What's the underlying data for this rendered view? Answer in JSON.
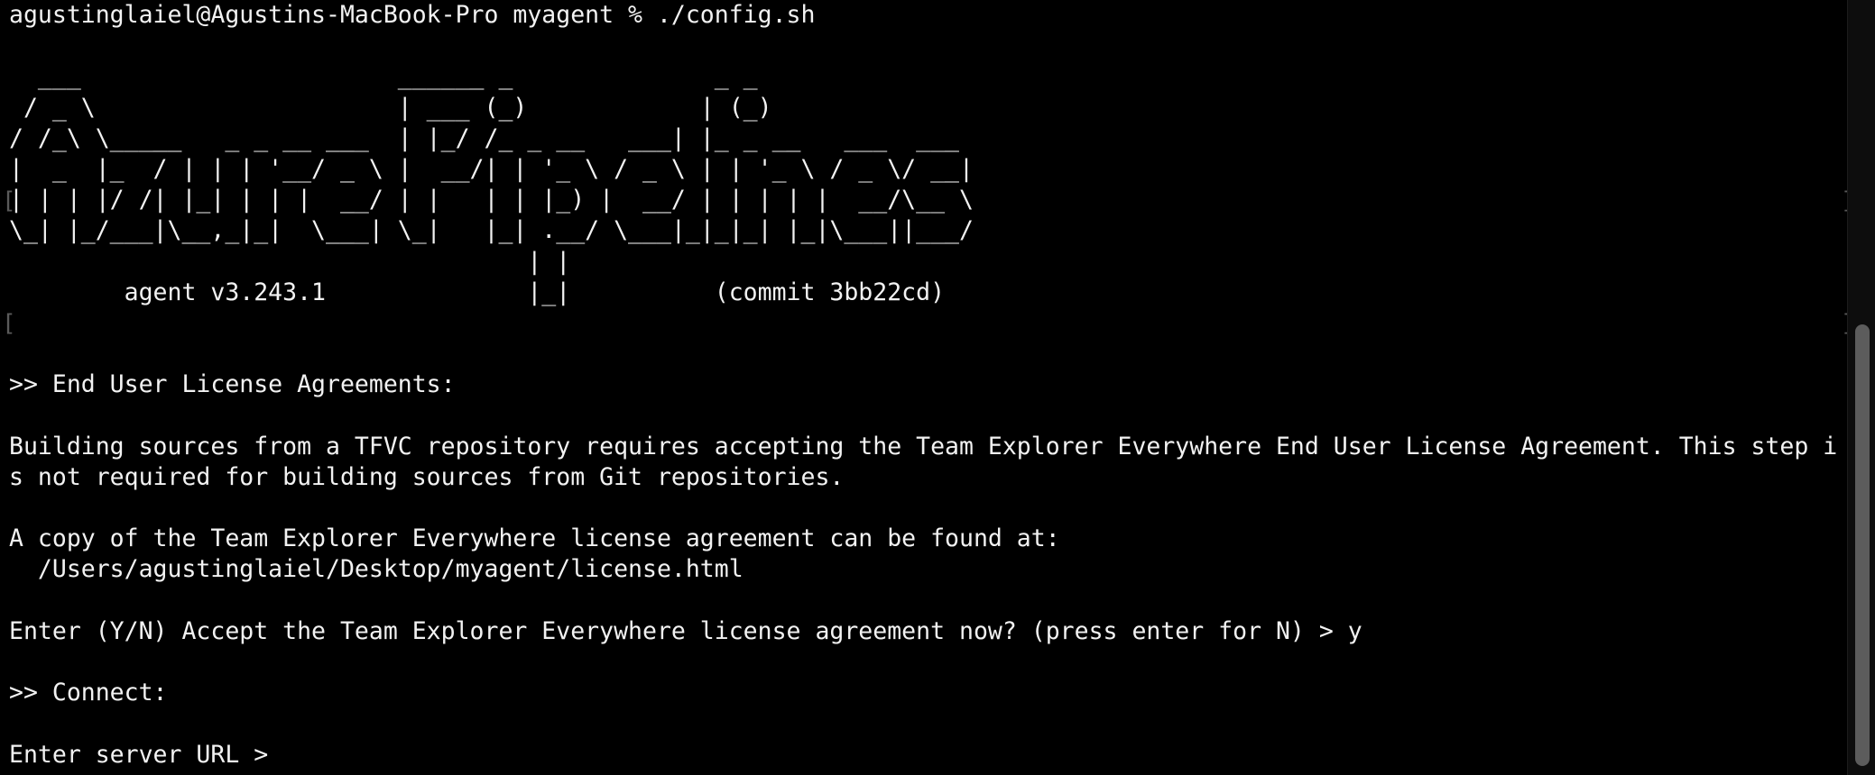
{
  "terminal": {
    "prompt_line": "agustinglaiel@Agustins-MacBook-Pro myagent % ./config.sh",
    "banner": [
      "",
      "  ___                      ______ _              _ _",
      " / _ \\                     | ___ (_)            | (_)",
      "/ /_\\ \\_____   _ _ __ ___  | |_/ /_ _ __   ___| |_ _ __   ___  ___",
      "|  _  |_  / | | | '__/ _ \\ |  __/| | '_ \\ / _ \\ | | '_ \\ / _ \\/ __|",
      "| | | |/ /| |_| | | |  __/ | |   | | |_) |  __/ | | | | |  __/\\__ \\",
      "\\_| |_/___|\\__,_|_|  \\___| \\_|   |_| .__/ \\___|_|_|_| |_|\\___||___/",
      "                                    | |",
      "        agent v3.243.1              |_|          (commit 3bb22cd)",
      ""
    ],
    "eula_header": ">> End User License Agreements:",
    "eula_text_1": "Building sources from a TFVC repository requires accepting the Team Explorer Everywhere End User License Agreement. This step i",
    "eula_text_2": "s not required for building sources from Git repositories.",
    "license_intro": "A copy of the Team Explorer Everywhere license agreement can be found at:",
    "license_path": "  /Users/agustinglaiel/Desktop/myagent/license.html",
    "accept_prompt": "Enter (Y/N) Accept the Team Explorer Everywhere license agreement now? (press enter for N) > y",
    "connect_header": ">> Connect:",
    "server_url_prompt": "Enter server URL > "
  },
  "colors": {
    "background": "#000000",
    "foreground": "#f2f2f2",
    "scrollbar_thumb": "#5c5c5c"
  }
}
